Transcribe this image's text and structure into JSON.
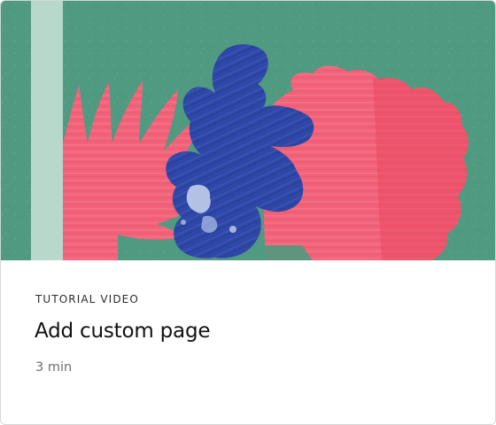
{
  "card": {
    "eyebrow": "TUTORIAL VIDEO",
    "title": "Add custom page",
    "duration": "3 min"
  },
  "thumbnail": {
    "icon": "abstract-leaf-illustration",
    "colors": {
      "background": "#4f9a80",
      "stripe": "#b9d8cc",
      "pink": "#f2637a",
      "pink_dark": "#e9485f",
      "blue": "#2f47a6"
    }
  }
}
